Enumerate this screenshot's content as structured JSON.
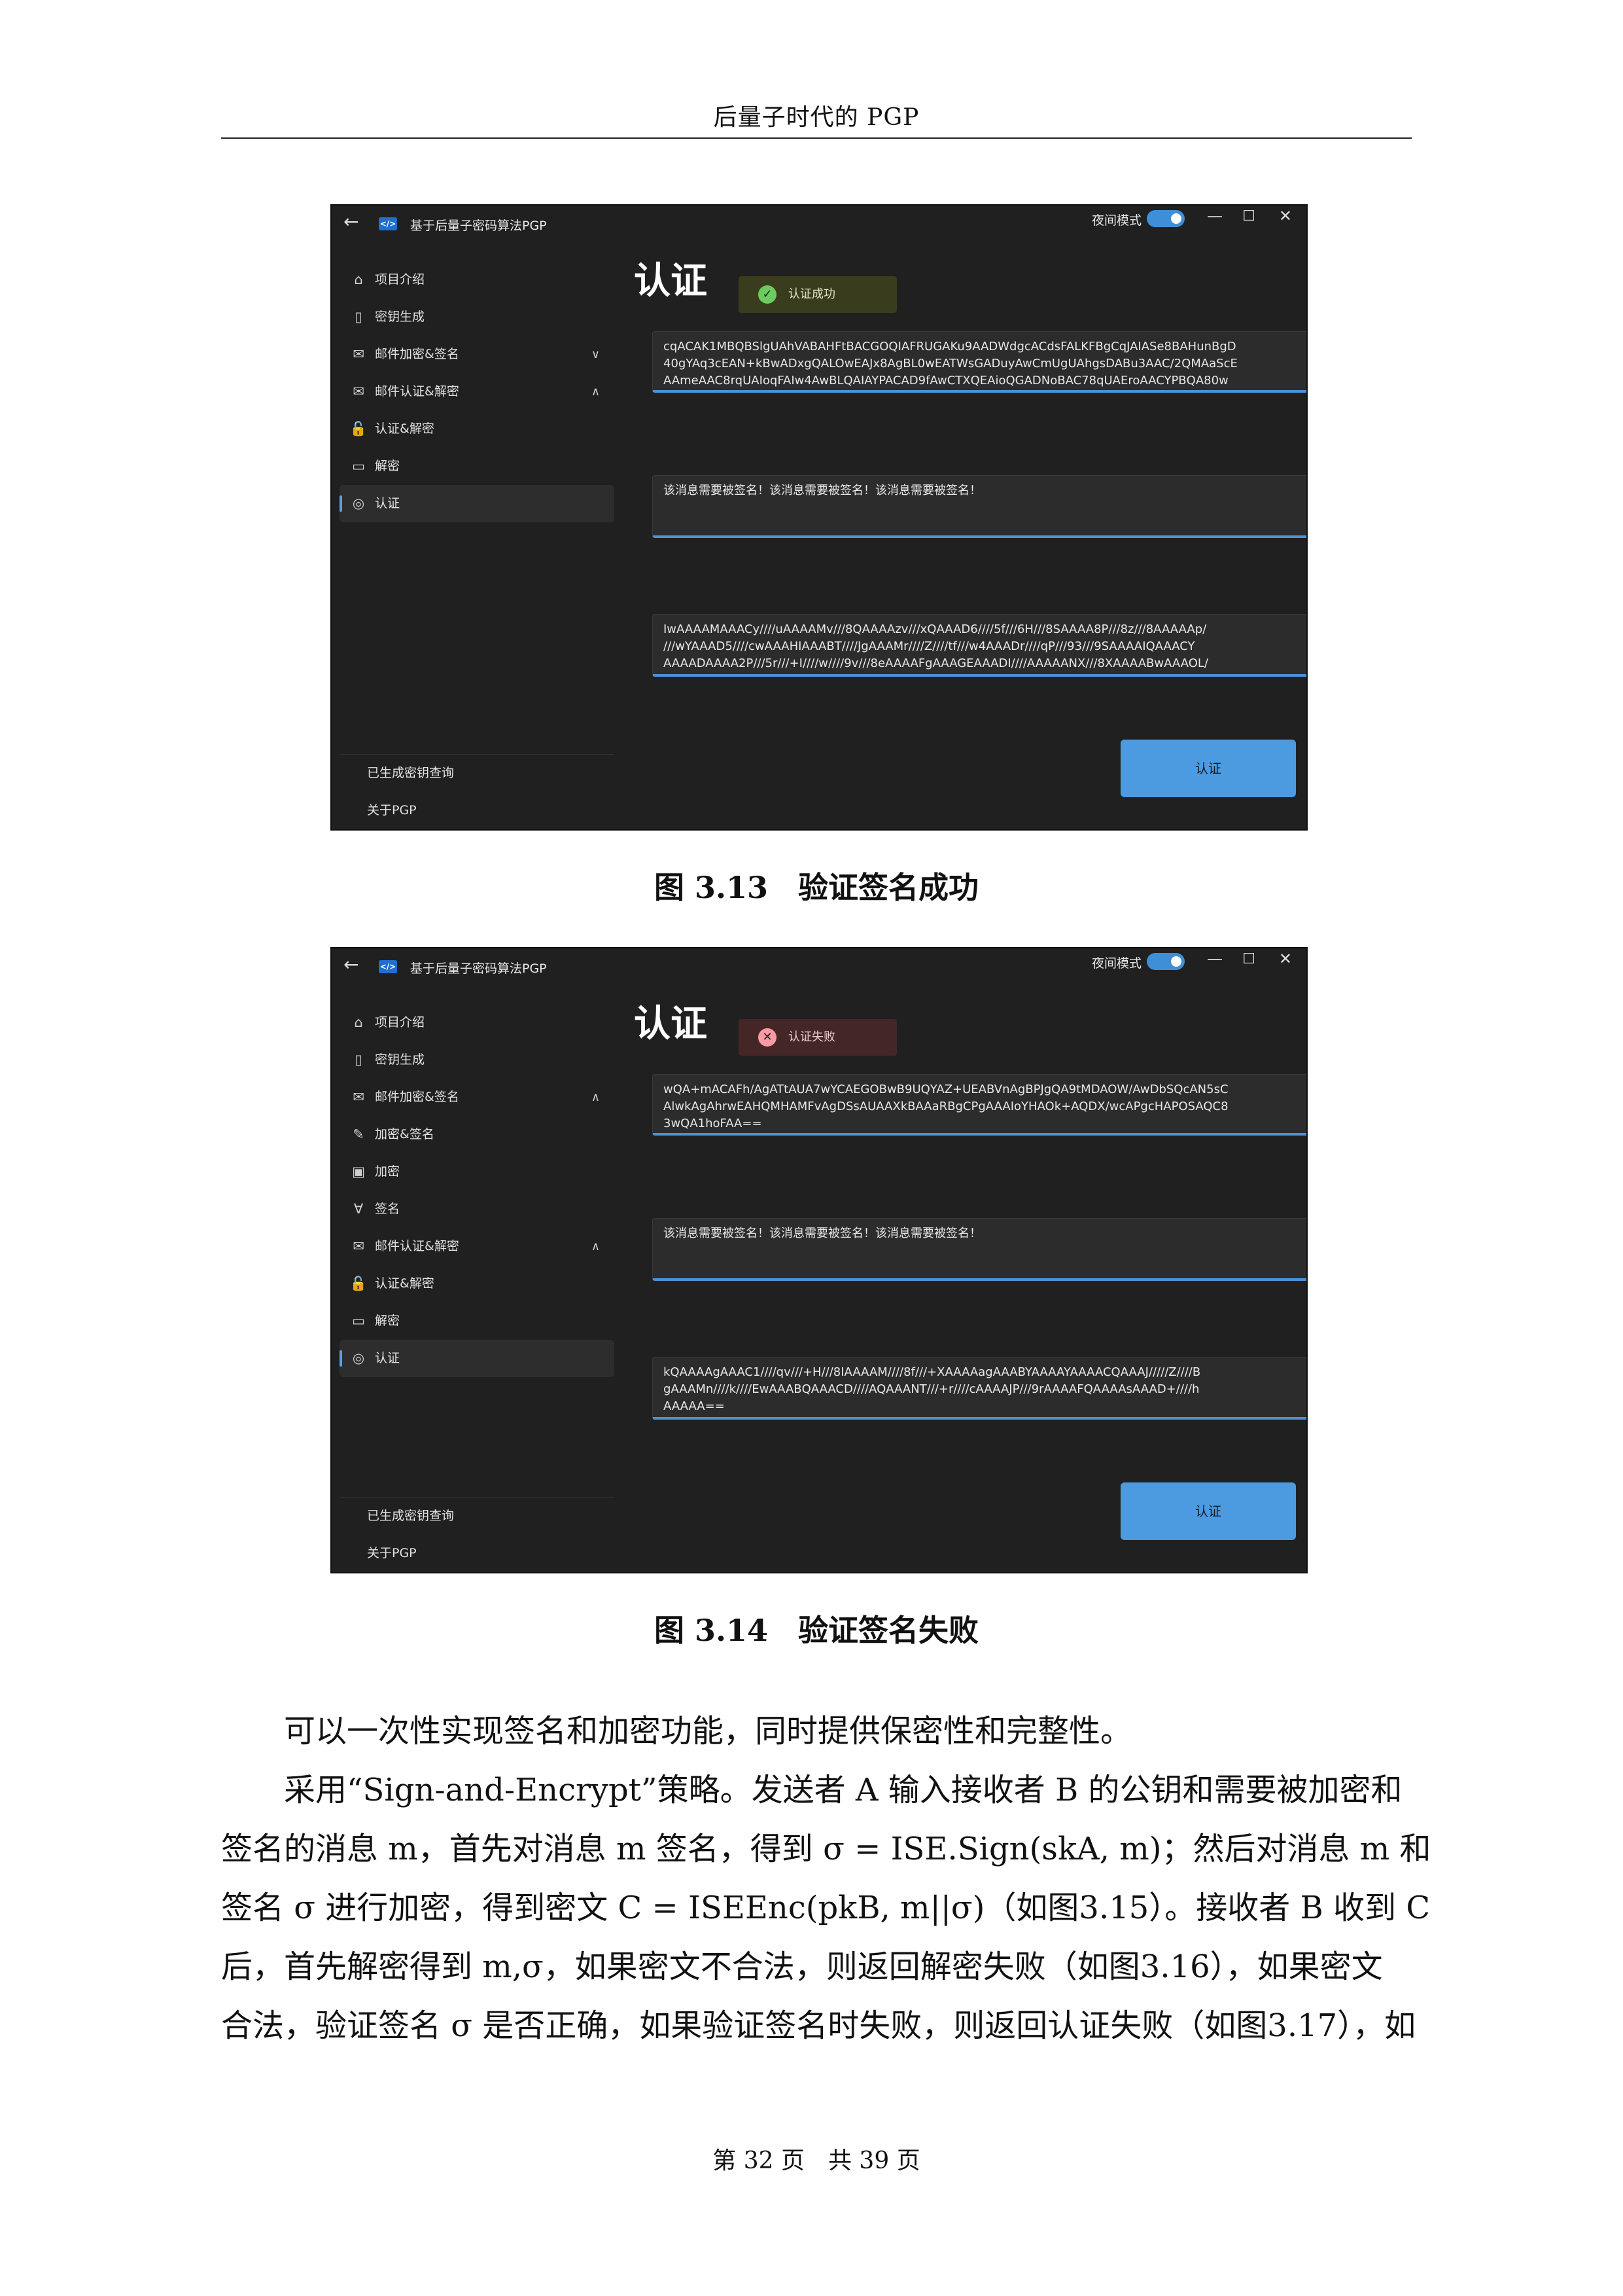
{
  "running_head": "后量子时代的 PGP",
  "figures": [
    {
      "app": {
        "title": "基于后量子密码算法PGP",
        "night_mode_label": "夜间模式",
        "nav_items": [
          {
            "icon": "home-icon",
            "label": "项目介绍",
            "chevron": ""
          },
          {
            "icon": "key-doc-icon",
            "label": "密钥生成",
            "chevron": ""
          },
          {
            "icon": "mail-lock-icon",
            "label": "邮件加密&签名",
            "chevron": "∨"
          },
          {
            "icon": "mail-lock-icon",
            "label": "邮件认证&解密",
            "chevron": "∧"
          },
          {
            "icon": "unlock-icon",
            "label": "认证&解密",
            "chevron": ""
          },
          {
            "icon": "document-icon",
            "label": "解密",
            "chevron": ""
          },
          {
            "icon": "fingerprint-icon",
            "label": "认证",
            "chevron": "",
            "selected": true
          }
        ],
        "nav_bottom": [
          "已生成密钥查询",
          "关于PGP"
        ],
        "heading": "认证",
        "status": {
          "type": "ok",
          "text": "认证成功"
        },
        "signature_lines": [
          "cqACAK1MBQBSlgUAhVABAHFtBACGOQIAFRUGAKu9AADWdgcACdsFALKFBgCqJAIASe8BAHunBgD",
          "40gYAq3cEAN+kBwADxgQALOwEAJx8AgBL0wEATWsGADuyAwCmUgUAhgsDABu3AAC/2QMAaScE",
          "AAmeAAC8rqUAIoqFAIw4AwBLQAIAYPACAD9fAwCTXQEAioQGADNoBAC78qUAEroAACYPBQA80w"
        ],
        "message": "该消息需要被签名！该消息需要被签名！该消息需要被签名！",
        "public_key_lines": [
          "IwAAAAMAAACy////uAAAAMv///8QAAAAzv///xQAAAD6////5f///6H///8SAAAA8P///8z///8AAAAAp/",
          "///wYAAAD5////cwAAAHIAAABT////JgAAAMr////Z////tf///w4AAADr////qP///93///9SAAAAIQAAACY",
          "AAAADAAAA2P///5r///+I////w////9v///8eAAAAFgAAAGEAAADI////AAAAANX///8XAAAABwAAAOL/"
        ],
        "button_label": "认证"
      },
      "number": "图 3.13",
      "title": "验证签名成功"
    },
    {
      "app": {
        "title": "基于后量子密码算法PGP",
        "night_mode_label": "夜间模式",
        "nav_items": [
          {
            "icon": "home-icon",
            "label": "项目介绍",
            "chevron": ""
          },
          {
            "icon": "key-doc-icon",
            "label": "密钥生成",
            "chevron": ""
          },
          {
            "icon": "mail-lock-icon",
            "label": "邮件加密&签名",
            "chevron": "∧"
          },
          {
            "icon": "pen-icon",
            "label": "加密&签名",
            "chevron": ""
          },
          {
            "icon": "lock-doc-icon",
            "label": "加密",
            "chevron": ""
          },
          {
            "icon": "sign-icon",
            "label": "签名",
            "chevron": ""
          },
          {
            "icon": "mail-lock-icon",
            "label": "邮件认证&解密",
            "chevron": "∧"
          },
          {
            "icon": "unlock-icon",
            "label": "认证&解密",
            "chevron": ""
          },
          {
            "icon": "document-icon",
            "label": "解密",
            "chevron": ""
          },
          {
            "icon": "fingerprint-icon",
            "label": "认证",
            "chevron": "",
            "selected": true
          }
        ],
        "nav_bottom": [
          "已生成密钥查询",
          "关于PGP"
        ],
        "heading": "认证",
        "status": {
          "type": "err",
          "text": "认证失败"
        },
        "signature_lines": [
          "wQA+mACAFh/AgATtAUA7wYCAEGOBwB9UQYAZ+UEABVnAgBPJgQA9tMDAOW/AwDbSQcAN5sC",
          "AlwkAgAhrwEAHQMHAMFvAgDSsAUAAXkBAAaRBgCPgAAAIoYHAOk+AQDX/wcAPgcHAPOSAQC8",
          "3wQA1hoFAA=="
        ],
        "message": "该消息需要被签名！该消息需要被签名！该消息需要被签名！",
        "public_key_lines": [
          "kQAAAAgAAAC1////qv///+H///8IAAAAM////8f///+XAAAAagAAABYAAAAYAAAACQAAAJ/////Z////B",
          "gAAAMn////k////EwAAABQAAACD////AQAAANT///+r////cAAAAJP///9rAAAAFQAAAAsAAAD+////h",
          "AAAAA=="
        ],
        "button_label": "认证"
      },
      "number": "图 3.14",
      "title": "验证签名失败"
    }
  ],
  "body_lines": [
    "可以一次性实现签名和加密功能，同时提供保密性和完整性。",
    "采用“Sign-and-Encrypt”策略。发送者 A 输入接收者 B 的公钥和需要被加密和",
    "签名的消息 m，首先对消息 m 签名，得到 σ = ISE.Sign(skA, m)；然后对消息 m 和",
    "签名 σ 进行加密，得到密文 C = ISEEnc(pkB, m||σ)（如图3.15）。接收者 B 收到 C",
    "后，首先解密得到 m,σ，如果密文不合法，则返回解密失败（如图3.16），如果密文",
    "合法，验证签名 σ 是否正确，如果验证签名时失败，则返回认证失败（如图3.17），如"
  ],
  "folio": "第 32 页　共 39 页"
}
